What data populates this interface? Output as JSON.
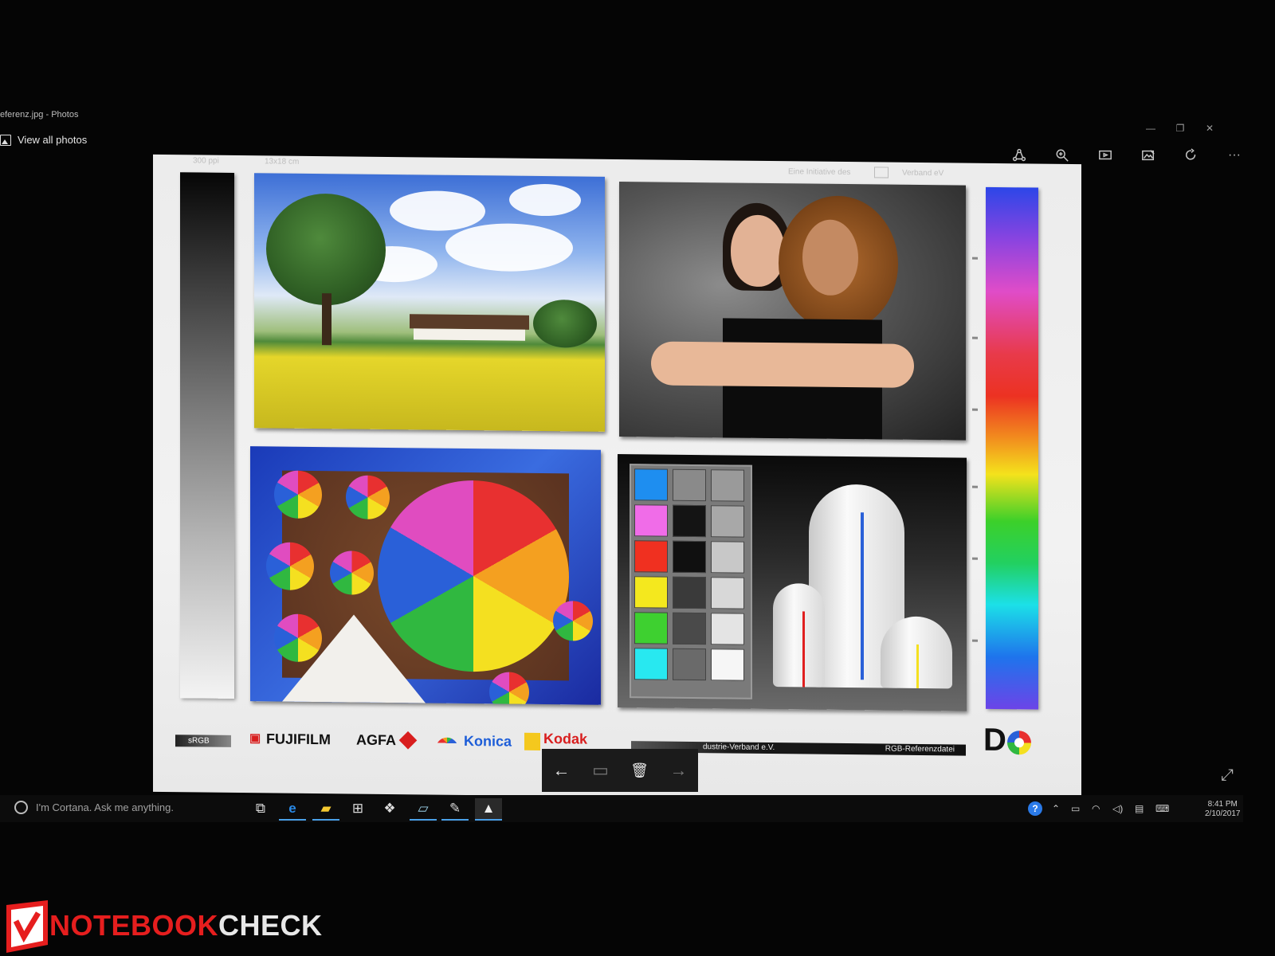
{
  "window": {
    "title": "eferenz.jpg - Photos",
    "view_all_label": "View all photos",
    "minimize": "—",
    "restore": "❐",
    "close": "✕"
  },
  "toolbar": {
    "icons": [
      "share-icon",
      "zoom-icon",
      "slideshow-icon",
      "edit-icon",
      "rotate-icon",
      "more-icon"
    ],
    "more_label": "···"
  },
  "image": {
    "ppi_label": "300 ppi",
    "size_label": "13x18 cm",
    "initiative_label": "Eine Initiative des",
    "verband_label": "Verband eV",
    "srgb_label": "sRGB",
    "logos": {
      "fujifilm": "FUJIFILM",
      "agfa": "AGFA",
      "konica": "Konica",
      "kodak": "Kodak"
    },
    "banner_left": "dustrie-Verband e.V.",
    "banner_right": "RGB-Referenzdatei",
    "do_logo": "D",
    "colors": {
      "fujifilm": "#d81e1e",
      "agfa": "#d81e1e",
      "konica": "#1e5ed8",
      "kodak": "#f4c81e"
    }
  },
  "swatches": {
    "left": [
      "#1e8ef0",
      "#f06ce8",
      "#f03020",
      "#f4e81e",
      "#3ed030",
      "#28e8f0"
    ],
    "middle": [
      "#8a8a8a",
      "#141414",
      "#101010",
      "#3a3a3a",
      "#4a4a4a",
      "#6a6a6a"
    ],
    "right": [
      "#9a9a9a",
      "#a8a8a8",
      "#c8c8c8",
      "#d8d8d8",
      "#e4e4e4",
      "#f6f6f6"
    ]
  },
  "overlay": {
    "prev": "←",
    "slideshow": "▭",
    "delete": "🗑",
    "next": "→",
    "expand": "⤢"
  },
  "taskbar": {
    "cortana_placeholder": "I'm Cortana. Ask me anything.",
    "tray_help": "?",
    "tray_chevron": "⌃",
    "time": "8:41 PM",
    "date": "2/10/2017"
  },
  "watermark": {
    "part1": "NOTEBOOK",
    "part2": "CHECK"
  }
}
